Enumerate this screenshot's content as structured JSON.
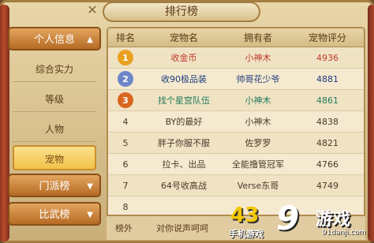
{
  "window": {
    "title": "排行榜",
    "close_glyph": "✕"
  },
  "menu": {
    "personal_info": "个人信息",
    "sub_items": [
      "综合实力",
      "等级",
      "人物",
      "宠物"
    ],
    "active_sub_index": 3,
    "faction_rank": "门派榜",
    "battle_rank": "比武榜"
  },
  "table": {
    "headers": [
      "排名",
      "宠物名",
      "拥有者",
      "宠物评分"
    ],
    "rows": [
      {
        "rank": "1",
        "pet": "收金币",
        "owner": "小神木",
        "score": "4936",
        "medal": "gold",
        "color": "#c0392b"
      },
      {
        "rank": "2",
        "pet": "收90极品装",
        "owner": "帅哥花少爷",
        "score": "4881",
        "medal": "silver",
        "color": "#1f3a7a"
      },
      {
        "rank": "3",
        "pet": "找个星宫队伍",
        "owner": "小神木",
        "score": "4861",
        "medal": "bronze",
        "color": "#1f7a5a"
      },
      {
        "rank": "4",
        "pet": "BY的最好",
        "owner": "小神木",
        "score": "4838",
        "medal": "",
        "color": "#4a3a2a"
      },
      {
        "rank": "5",
        "pet": "胖子你服不服",
        "owner": "佐罗罗",
        "score": "4821",
        "medal": "",
        "color": "#4a3a2a"
      },
      {
        "rank": "6",
        "pet": "拉卡、出品",
        "owner": "全能撸管冠军",
        "score": "4766",
        "medal": "",
        "color": "#4a3a2a"
      },
      {
        "rank": "7",
        "pet": "64号收高战",
        "owner": "Verse东哥",
        "score": "4749",
        "medal": "",
        "color": "#4a3a2a"
      },
      {
        "rank": "8",
        "pet": "",
        "owner": "",
        "score": "",
        "medal": "",
        "color": "#4a3a2a"
      }
    ]
  },
  "mine": {
    "rank": "榜外",
    "pet": "对你说声呵呵"
  },
  "watermark": {
    "number": "43",
    "logo": "9",
    "brand": "游戏",
    "domain": "91danji.com",
    "sub": "手机游戏"
  }
}
